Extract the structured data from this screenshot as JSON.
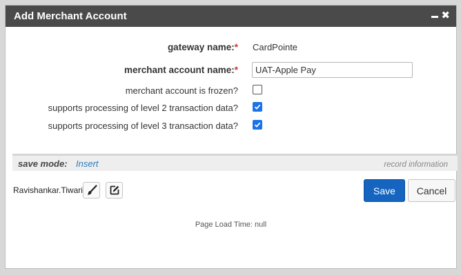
{
  "window": {
    "title": "Add Merchant Account",
    "minimize_icon": "minimize-icon",
    "close_icon": "close-icon"
  },
  "form": {
    "gateway_name": {
      "label": "gateway name:",
      "required_mark": "*",
      "value": "CardPointe"
    },
    "merchant_account_name": {
      "label": "merchant account name:",
      "required_mark": "*",
      "value": "UAT-Apple Pay"
    },
    "frozen": {
      "label": "merchant account is frozen?",
      "checked": false
    },
    "level2": {
      "label": "supports processing of level 2 transaction data?",
      "checked": true
    },
    "level3": {
      "label": "supports processing of level 3 transaction data?",
      "checked": true
    }
  },
  "save_bar": {
    "mode_label": "save mode:",
    "mode_value": "Insert",
    "record_info": "record information"
  },
  "footer": {
    "user": "Ravishankar.Tiwari",
    "brush_icon": "paintbrush-icon",
    "edit_icon": "edit-icon",
    "save_label": "Save",
    "cancel_label": "Cancel",
    "load_time": "Page Load Time: null"
  },
  "colors": {
    "titlebar": "#4a4a4a",
    "required": "#d0312d",
    "checkbox": "#1a73e8",
    "primary_button": "#1565c0",
    "link": "#2a7ab8"
  }
}
